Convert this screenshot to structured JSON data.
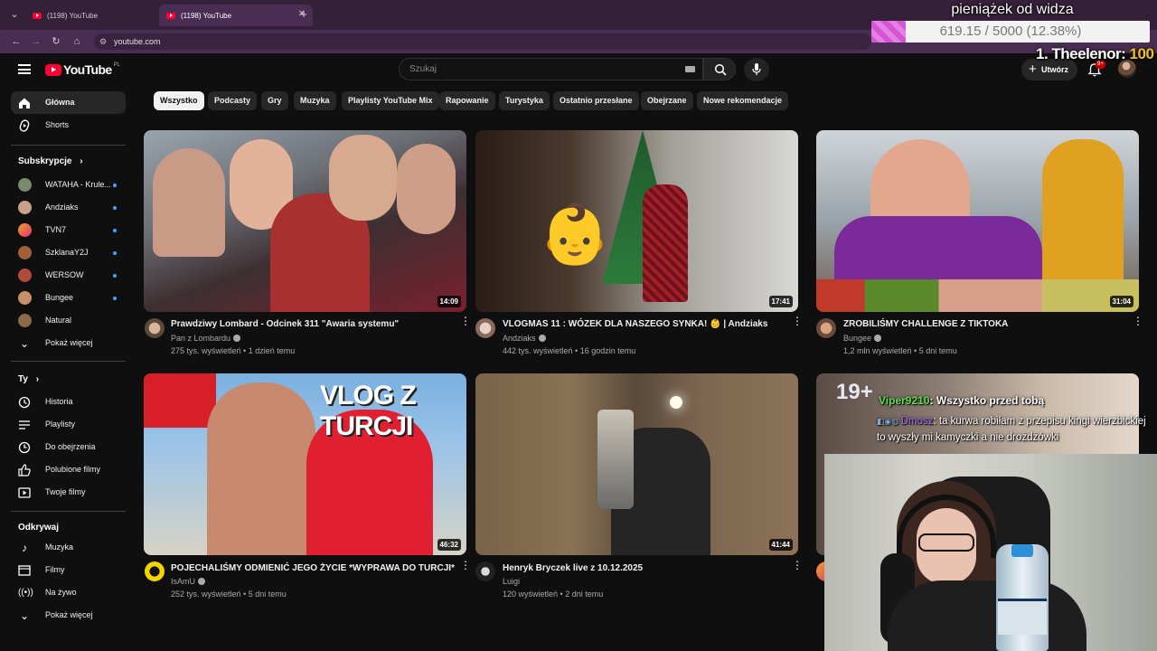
{
  "browser": {
    "tabs": [
      {
        "title": "(1198) YouTube"
      },
      {
        "title": "(1198) YouTube"
      }
    ],
    "url": "youtube.com"
  },
  "overlay": {
    "donation_title": "pieniążek od widza",
    "donation_progress": "619.15 / 5000 (12.38%)",
    "donation_fraction": 0.1238,
    "leader_name": "1. Theelenor:",
    "leader_amount": "100",
    "chat": [
      {
        "user": "Viper9210",
        "text": ": Wszystko przed tobą"
      },
      {
        "user": "Dmosz",
        "text": ": ta kurwa robiłam z przepisu kingi wierzbickiej to wyszły mi kamyczki a nie drożdżówki"
      }
    ],
    "age_badge": "19+"
  },
  "header": {
    "logo_text": "YouTube",
    "country": "PL",
    "search_placeholder": "Szukaj",
    "create_label": "Utwórz",
    "notifications_badge": "9+"
  },
  "sidebar": {
    "main": [
      {
        "label": "Główna",
        "icon": "home-icon"
      },
      {
        "label": "Shorts",
        "icon": "shorts-icon"
      }
    ],
    "subs_title": "Subskrypcje",
    "subscriptions": [
      {
        "label": "WATAHA - Krule...",
        "color": "#7a8a6a"
      },
      {
        "label": "Andziaks",
        "color": "#c9a08a"
      },
      {
        "label": "TVN7",
        "color": "#e0337a"
      },
      {
        "label": "SzklanaY2J",
        "color": "#a0603a"
      },
      {
        "label": "WERSOW",
        "color": "#b04a3a"
      },
      {
        "label": "Bungee",
        "color": "#c8906a"
      },
      {
        "label": "Natural",
        "color": "#8a6a4a"
      }
    ],
    "show_more": "Pokaż więcej",
    "you_title": "Ty",
    "you": [
      {
        "label": "Historia",
        "icon": "history-icon"
      },
      {
        "label": "Playlisty",
        "icon": "playlists-icon"
      },
      {
        "label": "Do obejrzenia",
        "icon": "watch-later-icon"
      },
      {
        "label": "Polubione filmy",
        "icon": "like-icon"
      },
      {
        "label": "Twoje filmy",
        "icon": "your-videos-icon"
      }
    ],
    "explore_title": "Odkrywaj",
    "explore": [
      {
        "label": "Muzyka",
        "icon": "music-icon"
      },
      {
        "label": "Filmy",
        "icon": "films-icon"
      },
      {
        "label": "Na żywo",
        "icon": "live-icon"
      },
      {
        "label": "Pokaż więcej",
        "icon": "chevron-down-icon"
      }
    ]
  },
  "chips": [
    "Wszystko",
    "Podcasty",
    "Gry",
    "Muzyka",
    "Playlisty YouTube Mix",
    "Rapowanie",
    "Turystyka",
    "Ostatnio przesłane",
    "Obejrzane",
    "Nowe rekomendacje"
  ],
  "videos": [
    {
      "title": "Prawdziwy Lombard - Odcinek 311 \"Awaria systemu\"",
      "channel": "Pan z Lombardu",
      "views": "275 tys. wyświetleń",
      "age": "1 dzień temu",
      "duration": "14:09"
    },
    {
      "title": "VLOGMAS 11 : WÓZEK DLA NASZEGO SYNKA! 👶 | Andziaks",
      "channel": "Andziaks",
      "views": "442 tys. wyświetleń",
      "age": "16 godzin temu",
      "duration": "17:41"
    },
    {
      "title": "ZROBILIŚMY CHALLENGE Z TIKTOKA",
      "channel": "Bungee",
      "views": "1,2 mln wyświetleń",
      "age": "5 dni temu",
      "duration": "31:04"
    },
    {
      "title": "POJECHALIŚMY ODMIENIĆ JEGO ŻYCIE *WYPRAWA DO TURCJI*",
      "channel": "IsAmU",
      "views": "252 tys. wyświetleń",
      "age": "5 dni temu",
      "duration": "46:32",
      "thumb_text": "VLOG Z TURCJI"
    },
    {
      "title": "Henryk Bryczek live z 10.12.2025",
      "channel": "Luigi",
      "views": "120 wyświetleń",
      "age": "2 dni temu",
      "duration": "41:44"
    }
  ]
}
